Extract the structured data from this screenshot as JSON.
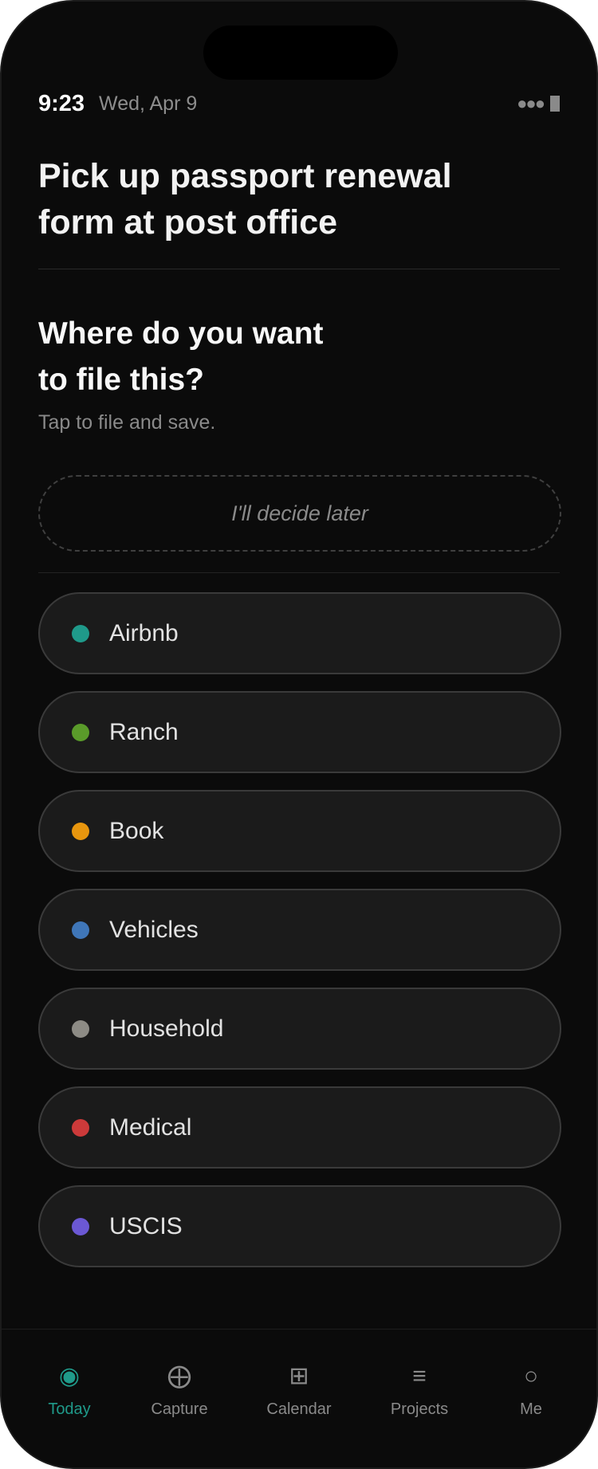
{
  "status_bar": {
    "time": "9:23",
    "date": "Wed, Apr 9"
  },
  "task": {
    "title": "Pick up passport renewal form at post office"
  },
  "filing": {
    "question_line1": "Where do you want",
    "question_line2": "to file this?",
    "hint": "Tap to file and save.",
    "decide_later": "I'll decide later"
  },
  "categories": [
    {
      "label": "Airbnb",
      "color": "#1f9a8a"
    },
    {
      "label": "Ranch",
      "color": "#5a9b2a"
    },
    {
      "label": "Book",
      "color": "#e8960e"
    },
    {
      "label": "Vehicles",
      "color": "#3f76b8"
    },
    {
      "label": "Household",
      "color": "#8d8b85"
    },
    {
      "label": "Medical",
      "color": "#cc3a3a"
    },
    {
      "label": "USCIS",
      "color": "#6b58d4"
    }
  ],
  "tabbar": {
    "active": "Today",
    "accent": "#1f9a8a",
    "tabs": [
      {
        "label": "Today",
        "icon": "target-icon",
        "glyph": "◉"
      },
      {
        "label": "Capture",
        "icon": "crosshair-icon",
        "glyph": "⨁"
      },
      {
        "label": "Calendar",
        "icon": "grid-icon",
        "glyph": "⊞"
      },
      {
        "label": "Projects",
        "icon": "list-icon",
        "glyph": "≡"
      },
      {
        "label": "Me",
        "icon": "circle-icon",
        "glyph": "○"
      }
    ]
  }
}
